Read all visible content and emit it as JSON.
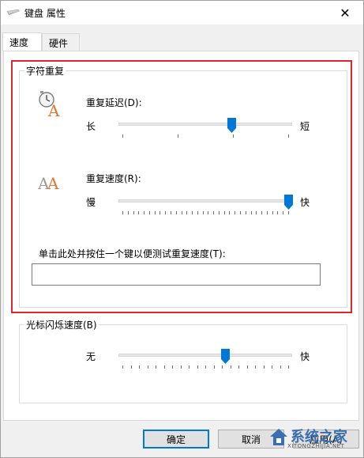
{
  "window": {
    "title": "键盘 属性",
    "close_glyph": "✕"
  },
  "tabs": [
    {
      "label": "速度",
      "active": true
    },
    {
      "label": "硬件",
      "active": false
    }
  ],
  "char_repeat": {
    "group_label": "字符重复",
    "delay": {
      "label": "重复延迟(D):",
      "left": "长",
      "right": "短",
      "value_fraction": 0.66,
      "tick_count": 4
    },
    "rate": {
      "label": "重复速度(R):",
      "left": "慢",
      "right": "快",
      "value_fraction": 1.0,
      "tick_count": 32
    },
    "test_label": "单击此处并按住一个键以便测试重复速度(T):",
    "test_value": ""
  },
  "cursor_blink": {
    "group_label": "光标闪烁速度(B)",
    "left": "无",
    "right": "快",
    "value_fraction": 0.62,
    "tick_count": 21
  },
  "buttons": {
    "ok": "确定",
    "cancel": "取消",
    "apply": "应用(A)"
  },
  "watermark": {
    "main": "系统之家",
    "sub": "XITONGZHIJIA.NET"
  },
  "colors": {
    "highlight": "#e0262f",
    "thumb": "#0078d7",
    "icon_orange": "#e2762e"
  },
  "icons": [
    "keyboard-icon",
    "clock-repeat-delay-icon",
    "repeat-rate-aa-icon"
  ]
}
